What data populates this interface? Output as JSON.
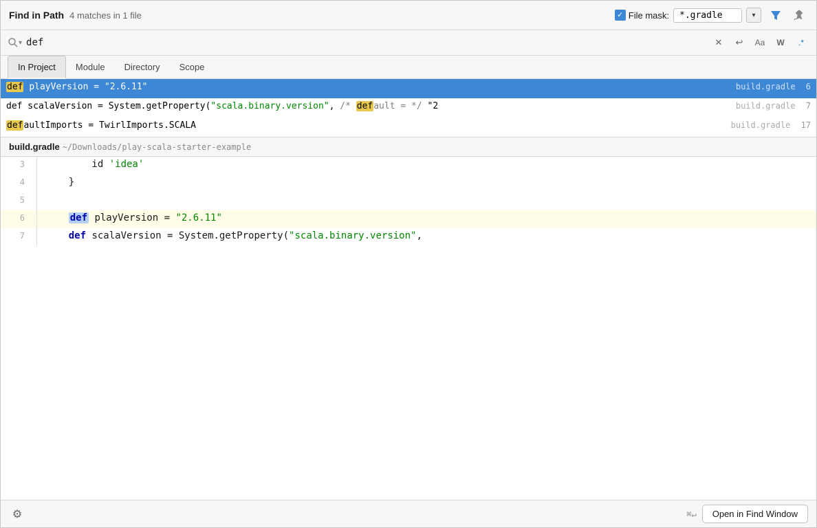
{
  "header": {
    "title": "Find in Path",
    "matches_text": "4 matches in 1 file",
    "file_mask_label": "File mask:",
    "file_mask_value": "*.gradle",
    "file_mask_checked": true
  },
  "search": {
    "query": "def",
    "placeholder": ""
  },
  "tabs": [
    {
      "id": "in-project",
      "label": "In Project",
      "active": true
    },
    {
      "id": "module",
      "label": "Module",
      "active": false
    },
    {
      "id": "directory",
      "label": "Directory",
      "active": false
    },
    {
      "id": "scope",
      "label": "Scope",
      "active": false
    }
  ],
  "results": [
    {
      "id": 1,
      "selected": true,
      "keyword": "def",
      "content_before": " ",
      "content_main": "playVersion = \"2.6.11\"",
      "content_after": "",
      "file_name": "build.gradle",
      "line_number": "6"
    },
    {
      "id": 2,
      "selected": false,
      "keyword": "def",
      "content_before": " scalaVersion = System.getProperty(\"scala.binary.version\", /* ",
      "content_main": "def",
      "content_after": "ault = */ \"2",
      "file_name": "build.gradle",
      "line_number": "7"
    },
    {
      "id": 3,
      "selected": false,
      "keyword": "def",
      "content_before": "aultImports = TwirlImports.SCALA",
      "content_main": "",
      "content_after": "",
      "file_name": "build.gradle",
      "line_number": "17"
    }
  ],
  "preview": {
    "file_name": "build.gradle",
    "file_path": "~/Downloads/play-scala-starter-example",
    "lines": [
      {
        "num": "3",
        "content": "        id 'idea'",
        "highlighted": false,
        "has_string": true,
        "string_part": "'idea'",
        "before_string": "        id "
      },
      {
        "num": "4",
        "content": "    }",
        "highlighted": false
      },
      {
        "num": "5",
        "content": "",
        "highlighted": false
      },
      {
        "num": "6",
        "content": "    def playVersion = \"2.6.11\"",
        "highlighted": true,
        "has_keyword": true,
        "keyword": "def",
        "after_keyword": " playVersion = ",
        "string_part": "\"2.6.11\""
      },
      {
        "num": "7",
        "content": "    def scalaVersion = System.getProperty(\"scala.binary.version\",",
        "highlighted": false,
        "has_keyword": true,
        "keyword": "def",
        "after_keyword": " scalaVersion = System.getProperty(",
        "string_part": "\"scala.binary.version\"",
        "after_string": ","
      }
    ]
  },
  "footer": {
    "keyboard_shortcut": "⌘↵",
    "open_btn_label": "Open in Find Window"
  },
  "icons": {
    "search": "🔍",
    "clear": "✕",
    "undo": "↩",
    "match_case": "Aa",
    "match_word": "W",
    "regex": ".*",
    "filter": "▼",
    "pin": "📌",
    "dropdown": "▾",
    "settings": "⚙"
  }
}
